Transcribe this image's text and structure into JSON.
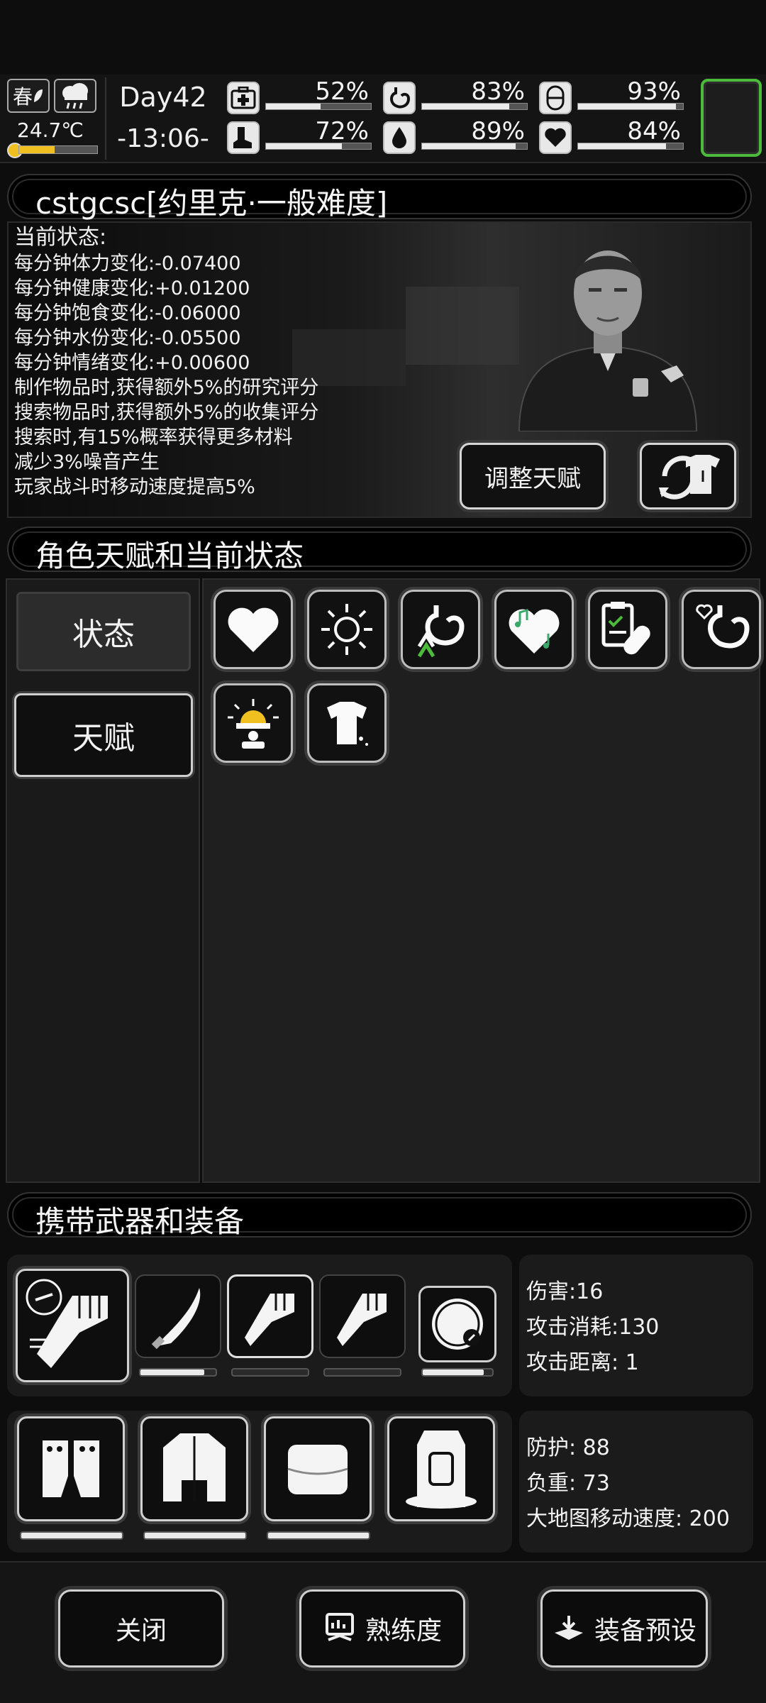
{
  "status_bar": {
    "season": "春",
    "temperature": "24.7℃",
    "temperature_level": 0.45,
    "day": "Day42",
    "time": "-13:06-",
    "stats": [
      {
        "name": "medical",
        "icon": "medkit-icon",
        "pct": "52%",
        "value": 0.52
      },
      {
        "name": "stomach",
        "icon": "stomach-icon",
        "pct": "83%",
        "value": 0.83
      },
      {
        "name": "mental",
        "icon": "pill-icon",
        "pct": "93%",
        "value": 0.93
      },
      {
        "name": "stamina",
        "icon": "boot-icon",
        "pct": "72%",
        "value": 0.72
      },
      {
        "name": "water",
        "icon": "water-drop-icon",
        "pct": "89%",
        "value": 0.89
      },
      {
        "name": "mood",
        "icon": "heart-icon",
        "pct": "84%",
        "value": 0.84
      }
    ]
  },
  "character": {
    "header": "cstgcsc[约里克·一般难度]",
    "status_title": "当前状态:",
    "lines": [
      "每分钟体力变化:-0.07400",
      "每分钟健康变化:+0.01200",
      "每分钟饱食变化:-0.06000",
      "每分钟水份变化:-0.05500",
      "每分钟情绪变化:+0.00600",
      "制作物品时,获得额外5%的研究评分",
      "搜索物品时,获得额外5%的收集评分",
      "搜索时,有15%概率获得更多材料",
      "减少3%噪音产生",
      "玩家战斗时移动速度提高5%"
    ],
    "adjust_talent_label": "调整天赋"
  },
  "talents_section": {
    "header": "角色天赋和当前状态",
    "tabs": {
      "state": "状态",
      "talent": "天赋"
    }
  },
  "equipment_section": {
    "header": "携带武器和装备",
    "weapon_durability": [
      0.85,
      0,
      0,
      0.88
    ],
    "armor_durability": [
      1.0,
      1.0,
      1.0
    ],
    "weapon_stats": [
      "伤害:16",
      "攻击消耗:130",
      "攻击距离: 1"
    ],
    "armor_stats": [
      "防护: 88",
      "负重: 73",
      "大地图移动速度: 200"
    ]
  },
  "buttons": {
    "close": "关闭",
    "proficiency": "熟练度",
    "preset": "装备预设"
  },
  "colors": {
    "accent_green": "#4cbb3c",
    "panel_bg": "#1f1f1f",
    "text": "#f2f2f2"
  }
}
